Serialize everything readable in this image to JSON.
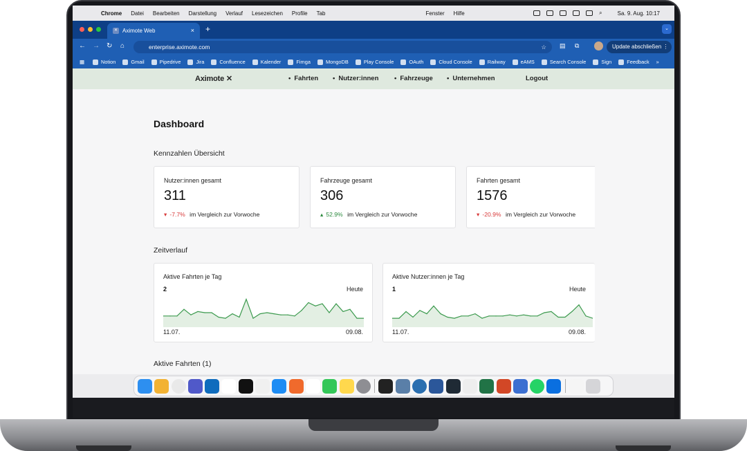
{
  "menubar": {
    "app": "Chrome",
    "items": [
      "Datei",
      "Bearbeiten",
      "Darstellung",
      "Verlauf",
      "Lesezeichen",
      "Profile",
      "Tab"
    ],
    "right_items": [
      "Fenster",
      "Hilfe"
    ],
    "datetime": "Sa. 9. Aug.  10:17"
  },
  "browser": {
    "tab_title": "Aximote Web",
    "url": "enterprise.aximote.com",
    "update_button": "Update abschließen",
    "bookmarks": [
      "Notion",
      "Gmail",
      "Pipedrive",
      "Jira",
      "Confluence",
      "Kalender",
      "Fimga",
      "MongoDB",
      "Play Console",
      "OAuth",
      "Cloud Console",
      "Railway",
      "eAMS",
      "Search Console",
      "Sign",
      "Feedback"
    ]
  },
  "site": {
    "logo": "Aximote",
    "nav": [
      "Fahrten",
      "Nutzer:innen",
      "Fahrzeuge",
      "Unternehmen"
    ],
    "logout": "Logout"
  },
  "dashboard": {
    "title": "Dashboard",
    "kpi_section": "Kennzahlen Übersicht",
    "kpis": [
      {
        "label": "Nutzer:innen gesamt",
        "value": "311",
        "change": "-7.7%",
        "direction": "down",
        "suffix": "im Vergleich zur Vorwoche"
      },
      {
        "label": "Fahrzeuge gesamt",
        "value": "306",
        "change": "52.9%",
        "direction": "up",
        "suffix": "im Vergleich zur Vorwoche"
      },
      {
        "label": "Fahrten gesamt",
        "value": "1576",
        "change": "-20.9%",
        "direction": "down",
        "suffix": "im Vergleich zur Vorwoche"
      }
    ],
    "timeline_section": "Zeitverlauf",
    "active_section": "Aktive Fahrten (1)"
  },
  "colors": {
    "line": "#3c9a4e",
    "fill": "#e3efe3",
    "down": "#d83a3a",
    "up": "#2b8a3e"
  },
  "chart_data": [
    {
      "type": "area",
      "title": "Aktive Fahrten je Tag",
      "current_value": "2",
      "current_label": "Heute",
      "x_start": "11.07.",
      "x_end": "09.08.",
      "values": [
        1,
        1,
        1,
        1.6,
        1.1,
        1.4,
        1.3,
        1.3,
        0.9,
        0.8,
        1.2,
        0.9,
        2.5,
        0.8,
        1.2,
        1.3,
        1.2,
        1.1,
        1.1,
        1,
        1.5,
        2.2,
        1.9,
        2.1,
        1.3,
        2.1,
        1.4,
        1.6,
        0.8,
        0.8
      ]
    },
    {
      "type": "area",
      "title": "Aktive Nutzer:innen je Tag",
      "current_value": "1",
      "current_label": "Heute",
      "x_start": "11.07.",
      "x_end": "09.08.",
      "values": [
        0.8,
        0.8,
        1.4,
        0.9,
        1.5,
        1.2,
        1.9,
        1.2,
        0.9,
        0.8,
        1,
        1,
        1.2,
        0.8,
        1,
        1,
        1,
        1.1,
        1,
        1.1,
        1,
        1,
        1.3,
        1.4,
        0.9,
        0.9,
        1.4,
        2,
        1,
        0.8
      ]
    }
  ]
}
